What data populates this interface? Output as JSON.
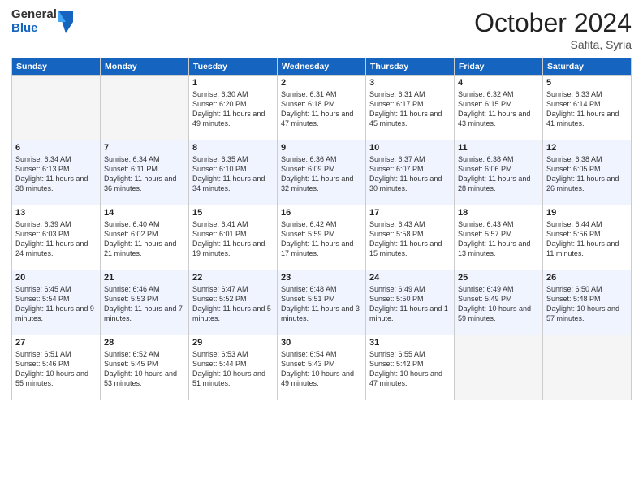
{
  "header": {
    "logo": {
      "general": "General",
      "blue": "Blue"
    },
    "title": "October 2024",
    "location": "Safita, Syria"
  },
  "days_of_week": [
    "Sunday",
    "Monday",
    "Tuesday",
    "Wednesday",
    "Thursday",
    "Friday",
    "Saturday"
  ],
  "weeks": [
    [
      {
        "day": "",
        "detail": ""
      },
      {
        "day": "",
        "detail": ""
      },
      {
        "day": "1",
        "detail": "Sunrise: 6:30 AM\nSunset: 6:20 PM\nDaylight: 11 hours and 49 minutes."
      },
      {
        "day": "2",
        "detail": "Sunrise: 6:31 AM\nSunset: 6:18 PM\nDaylight: 11 hours and 47 minutes."
      },
      {
        "day": "3",
        "detail": "Sunrise: 6:31 AM\nSunset: 6:17 PM\nDaylight: 11 hours and 45 minutes."
      },
      {
        "day": "4",
        "detail": "Sunrise: 6:32 AM\nSunset: 6:15 PM\nDaylight: 11 hours and 43 minutes."
      },
      {
        "day": "5",
        "detail": "Sunrise: 6:33 AM\nSunset: 6:14 PM\nDaylight: 11 hours and 41 minutes."
      }
    ],
    [
      {
        "day": "6",
        "detail": "Sunrise: 6:34 AM\nSunset: 6:13 PM\nDaylight: 11 hours and 38 minutes."
      },
      {
        "day": "7",
        "detail": "Sunrise: 6:34 AM\nSunset: 6:11 PM\nDaylight: 11 hours and 36 minutes."
      },
      {
        "day": "8",
        "detail": "Sunrise: 6:35 AM\nSunset: 6:10 PM\nDaylight: 11 hours and 34 minutes."
      },
      {
        "day": "9",
        "detail": "Sunrise: 6:36 AM\nSunset: 6:09 PM\nDaylight: 11 hours and 32 minutes."
      },
      {
        "day": "10",
        "detail": "Sunrise: 6:37 AM\nSunset: 6:07 PM\nDaylight: 11 hours and 30 minutes."
      },
      {
        "day": "11",
        "detail": "Sunrise: 6:38 AM\nSunset: 6:06 PM\nDaylight: 11 hours and 28 minutes."
      },
      {
        "day": "12",
        "detail": "Sunrise: 6:38 AM\nSunset: 6:05 PM\nDaylight: 11 hours and 26 minutes."
      }
    ],
    [
      {
        "day": "13",
        "detail": "Sunrise: 6:39 AM\nSunset: 6:03 PM\nDaylight: 11 hours and 24 minutes."
      },
      {
        "day": "14",
        "detail": "Sunrise: 6:40 AM\nSunset: 6:02 PM\nDaylight: 11 hours and 21 minutes."
      },
      {
        "day": "15",
        "detail": "Sunrise: 6:41 AM\nSunset: 6:01 PM\nDaylight: 11 hours and 19 minutes."
      },
      {
        "day": "16",
        "detail": "Sunrise: 6:42 AM\nSunset: 5:59 PM\nDaylight: 11 hours and 17 minutes."
      },
      {
        "day": "17",
        "detail": "Sunrise: 6:43 AM\nSunset: 5:58 PM\nDaylight: 11 hours and 15 minutes."
      },
      {
        "day": "18",
        "detail": "Sunrise: 6:43 AM\nSunset: 5:57 PM\nDaylight: 11 hours and 13 minutes."
      },
      {
        "day": "19",
        "detail": "Sunrise: 6:44 AM\nSunset: 5:56 PM\nDaylight: 11 hours and 11 minutes."
      }
    ],
    [
      {
        "day": "20",
        "detail": "Sunrise: 6:45 AM\nSunset: 5:54 PM\nDaylight: 11 hours and 9 minutes."
      },
      {
        "day": "21",
        "detail": "Sunrise: 6:46 AM\nSunset: 5:53 PM\nDaylight: 11 hours and 7 minutes."
      },
      {
        "day": "22",
        "detail": "Sunrise: 6:47 AM\nSunset: 5:52 PM\nDaylight: 11 hours and 5 minutes."
      },
      {
        "day": "23",
        "detail": "Sunrise: 6:48 AM\nSunset: 5:51 PM\nDaylight: 11 hours and 3 minutes."
      },
      {
        "day": "24",
        "detail": "Sunrise: 6:49 AM\nSunset: 5:50 PM\nDaylight: 11 hours and 1 minute."
      },
      {
        "day": "25",
        "detail": "Sunrise: 6:49 AM\nSunset: 5:49 PM\nDaylight: 10 hours and 59 minutes."
      },
      {
        "day": "26",
        "detail": "Sunrise: 6:50 AM\nSunset: 5:48 PM\nDaylight: 10 hours and 57 minutes."
      }
    ],
    [
      {
        "day": "27",
        "detail": "Sunrise: 6:51 AM\nSunset: 5:46 PM\nDaylight: 10 hours and 55 minutes."
      },
      {
        "day": "28",
        "detail": "Sunrise: 6:52 AM\nSunset: 5:45 PM\nDaylight: 10 hours and 53 minutes."
      },
      {
        "day": "29",
        "detail": "Sunrise: 6:53 AM\nSunset: 5:44 PM\nDaylight: 10 hours and 51 minutes."
      },
      {
        "day": "30",
        "detail": "Sunrise: 6:54 AM\nSunset: 5:43 PM\nDaylight: 10 hours and 49 minutes."
      },
      {
        "day": "31",
        "detail": "Sunrise: 6:55 AM\nSunset: 5:42 PM\nDaylight: 10 hours and 47 minutes."
      },
      {
        "day": "",
        "detail": ""
      },
      {
        "day": "",
        "detail": ""
      }
    ]
  ]
}
